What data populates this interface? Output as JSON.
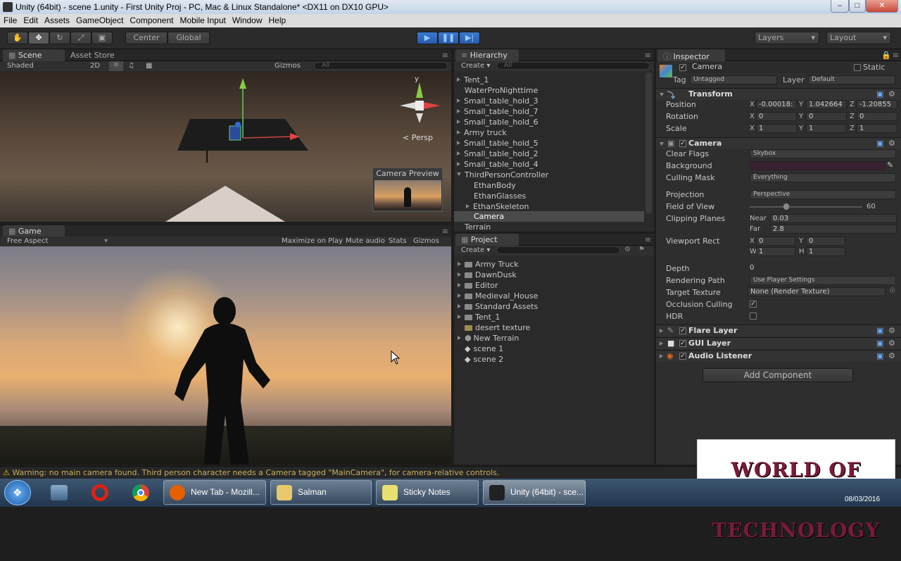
{
  "window": {
    "title": "Unity (64bit) - scene 1.unity - First Unity Proj - PC, Mac & Linux Standalone* <DX11 on DX10 GPU>"
  },
  "menu": [
    "File",
    "Edit",
    "Assets",
    "GameObject",
    "Component",
    "Mobile Input",
    "Window",
    "Help"
  ],
  "toolbar": {
    "center": "Center",
    "global": "Global",
    "layers": "Layers",
    "layout": "Layout"
  },
  "scene": {
    "tab": "Scene",
    "tab2": "Asset Store",
    "shaded": "Shaded",
    "twod": "2D",
    "gizmos": "Gizmos",
    "search": "All",
    "persp": "Persp",
    "axis_y": "y",
    "camera_preview": "Camera Preview"
  },
  "game": {
    "tab": "Game",
    "aspect": "Free Aspect",
    "maximize": "Maximize on Play",
    "mute": "Mute audio",
    "stats": "Stats",
    "gizmos": "Gizmos"
  },
  "hierarchy": {
    "tab": "Hierarchy",
    "create": "Create",
    "search": "All",
    "items": [
      {
        "label": "Tent_1",
        "indent": 0,
        "arrow": true
      },
      {
        "label": "WaterProNighttime",
        "indent": 0,
        "arrow": false
      },
      {
        "label": "Small_table_hold_3",
        "indent": 0,
        "arrow": true
      },
      {
        "label": "Small_table_hold_7",
        "indent": 0,
        "arrow": true
      },
      {
        "label": "Small_table_hold_6",
        "indent": 0,
        "arrow": true
      },
      {
        "label": "Army truck",
        "indent": 0,
        "arrow": true
      },
      {
        "label": "Small_table_hold_5",
        "indent": 0,
        "arrow": true
      },
      {
        "label": "Small_table_hold_2",
        "indent": 0,
        "arrow": true
      },
      {
        "label": "Small_table_hold_4",
        "indent": 0,
        "arrow": true
      },
      {
        "label": "ThirdPersonController",
        "indent": 0,
        "arrow": "down"
      },
      {
        "label": "EthanBody",
        "indent": 1,
        "arrow": false
      },
      {
        "label": "EthanGlasses",
        "indent": 1,
        "arrow": false
      },
      {
        "label": "EthanSkeleton",
        "indent": 1,
        "arrow": true
      },
      {
        "label": "Camera",
        "indent": 1,
        "arrow": false,
        "selected": true
      },
      {
        "label": "Terrain",
        "indent": 0,
        "arrow": false
      }
    ]
  },
  "project": {
    "tab": "Project",
    "create": "Create",
    "items": [
      {
        "label": "Army Truck",
        "kind": "folder",
        "arrow": true
      },
      {
        "label": "DawnDusk",
        "kind": "folder",
        "arrow": true
      },
      {
        "label": "Editor",
        "kind": "folder",
        "arrow": true
      },
      {
        "label": "Medieval_House",
        "kind": "folder",
        "arrow": true
      },
      {
        "label": "Standard Assets",
        "kind": "folder",
        "arrow": true
      },
      {
        "label": "Tent_1",
        "kind": "folder",
        "arrow": true
      },
      {
        "label": "desert texture",
        "kind": "folder-yellow",
        "arrow": false
      },
      {
        "label": "New Terrain",
        "kind": "terrain",
        "arrow": true
      },
      {
        "label": "scene 1",
        "kind": "unity",
        "arrow": false
      },
      {
        "label": "scene 2",
        "kind": "unity",
        "arrow": false
      }
    ]
  },
  "inspector": {
    "tab": "Inspector",
    "object_name": "Camera",
    "static": "Static",
    "tag_label": "Tag",
    "tag": "Untagged",
    "layer_label": "Layer",
    "layer": "Default",
    "transform": {
      "title": "Transform",
      "position_label": "Position",
      "rotation_label": "Rotation",
      "scale_label": "Scale",
      "x": "X",
      "y": "Y",
      "z": "Z",
      "position": [
        "-0.00018:",
        "1.042664",
        "-1.20855"
      ],
      "rotation": [
        "0",
        "0",
        "0"
      ],
      "scale": [
        "1",
        "1",
        "1"
      ]
    },
    "camera": {
      "title": "Camera",
      "clear_flags_label": "Clear Flags",
      "clear_flags": "Skybox",
      "background_label": "Background",
      "background_color": "#3a2030",
      "culling_label": "Culling Mask",
      "culling": "Everything",
      "projection_label": "Projection",
      "projection": "Perspective",
      "fov_label": "Field of View",
      "fov": "60",
      "clip_label": "Clipping Planes",
      "near_label": "Near",
      "near": "0.03",
      "far_label": "Far",
      "far": "2.8",
      "viewport_label": "Viewport Rect",
      "vx": "0",
      "vy": "0",
      "w_label": "W",
      "vw": "1",
      "h_label": "H",
      "vh": "1",
      "depth_label": "Depth",
      "depth": "0",
      "rendering_label": "Rendering Path",
      "rendering": "Use Player Settings",
      "target_label": "Target Texture",
      "target": "None (Render Texture)",
      "occlusion_label": "Occlusion Culling",
      "occlusion_check": "✓",
      "hdr_label": "HDR"
    },
    "components": [
      "Flare Layer",
      "GUI Layer",
      "Audio Listener"
    ],
    "add_component": "Add Component"
  },
  "status": {
    "warning": "Warning: no main camera found. Third person character needs a Camera tagged \"MainCamera\", for camera-relative controls."
  },
  "watermark": {
    "text": "WORLD OF TECHNOLOGY"
  },
  "taskbar": {
    "apps": [
      {
        "label": "New Tab - Mozill...",
        "color": "#e66000"
      },
      {
        "label": "Salman",
        "color": "#e8c86a"
      },
      {
        "label": "Sticky Notes",
        "color": "#e8e070"
      },
      {
        "label": "Unity (64bit) - sce...",
        "color": "#222222"
      }
    ],
    "clock": "08/03/2016"
  }
}
